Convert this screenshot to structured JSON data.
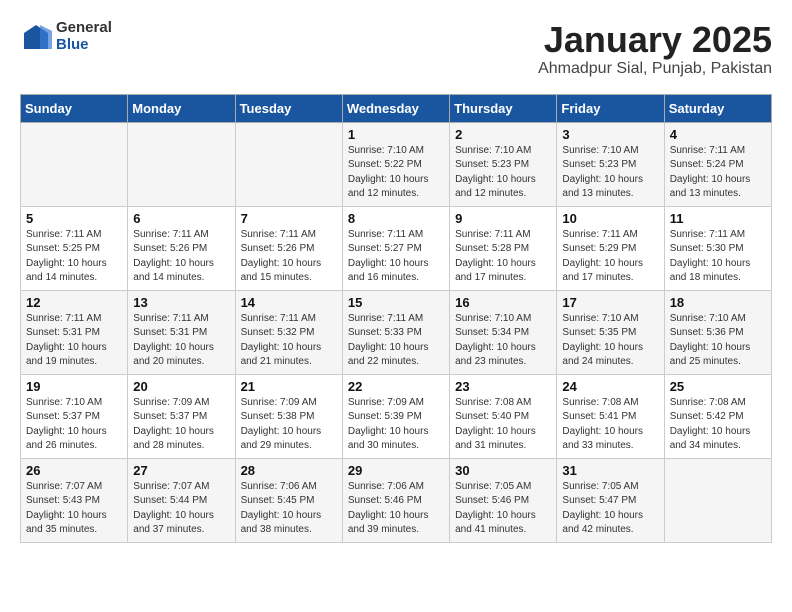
{
  "logo": {
    "general": "General",
    "blue": "Blue"
  },
  "header": {
    "title": "January 2025",
    "subtitle": "Ahmadpur Sial, Punjab, Pakistan"
  },
  "weekdays": [
    "Sunday",
    "Monday",
    "Tuesday",
    "Wednesday",
    "Thursday",
    "Friday",
    "Saturday"
  ],
  "weeks": [
    [
      {
        "day": "",
        "info": ""
      },
      {
        "day": "",
        "info": ""
      },
      {
        "day": "",
        "info": ""
      },
      {
        "day": "1",
        "info": "Sunrise: 7:10 AM\nSunset: 5:22 PM\nDaylight: 10 hours\nand 12 minutes."
      },
      {
        "day": "2",
        "info": "Sunrise: 7:10 AM\nSunset: 5:23 PM\nDaylight: 10 hours\nand 12 minutes."
      },
      {
        "day": "3",
        "info": "Sunrise: 7:10 AM\nSunset: 5:23 PM\nDaylight: 10 hours\nand 13 minutes."
      },
      {
        "day": "4",
        "info": "Sunrise: 7:11 AM\nSunset: 5:24 PM\nDaylight: 10 hours\nand 13 minutes."
      }
    ],
    [
      {
        "day": "5",
        "info": "Sunrise: 7:11 AM\nSunset: 5:25 PM\nDaylight: 10 hours\nand 14 minutes."
      },
      {
        "day": "6",
        "info": "Sunrise: 7:11 AM\nSunset: 5:26 PM\nDaylight: 10 hours\nand 14 minutes."
      },
      {
        "day": "7",
        "info": "Sunrise: 7:11 AM\nSunset: 5:26 PM\nDaylight: 10 hours\nand 15 minutes."
      },
      {
        "day": "8",
        "info": "Sunrise: 7:11 AM\nSunset: 5:27 PM\nDaylight: 10 hours\nand 16 minutes."
      },
      {
        "day": "9",
        "info": "Sunrise: 7:11 AM\nSunset: 5:28 PM\nDaylight: 10 hours\nand 17 minutes."
      },
      {
        "day": "10",
        "info": "Sunrise: 7:11 AM\nSunset: 5:29 PM\nDaylight: 10 hours\nand 17 minutes."
      },
      {
        "day": "11",
        "info": "Sunrise: 7:11 AM\nSunset: 5:30 PM\nDaylight: 10 hours\nand 18 minutes."
      }
    ],
    [
      {
        "day": "12",
        "info": "Sunrise: 7:11 AM\nSunset: 5:31 PM\nDaylight: 10 hours\nand 19 minutes."
      },
      {
        "day": "13",
        "info": "Sunrise: 7:11 AM\nSunset: 5:31 PM\nDaylight: 10 hours\nand 20 minutes."
      },
      {
        "day": "14",
        "info": "Sunrise: 7:11 AM\nSunset: 5:32 PM\nDaylight: 10 hours\nand 21 minutes."
      },
      {
        "day": "15",
        "info": "Sunrise: 7:11 AM\nSunset: 5:33 PM\nDaylight: 10 hours\nand 22 minutes."
      },
      {
        "day": "16",
        "info": "Sunrise: 7:10 AM\nSunset: 5:34 PM\nDaylight: 10 hours\nand 23 minutes."
      },
      {
        "day": "17",
        "info": "Sunrise: 7:10 AM\nSunset: 5:35 PM\nDaylight: 10 hours\nand 24 minutes."
      },
      {
        "day": "18",
        "info": "Sunrise: 7:10 AM\nSunset: 5:36 PM\nDaylight: 10 hours\nand 25 minutes."
      }
    ],
    [
      {
        "day": "19",
        "info": "Sunrise: 7:10 AM\nSunset: 5:37 PM\nDaylight: 10 hours\nand 26 minutes."
      },
      {
        "day": "20",
        "info": "Sunrise: 7:09 AM\nSunset: 5:37 PM\nDaylight: 10 hours\nand 28 minutes."
      },
      {
        "day": "21",
        "info": "Sunrise: 7:09 AM\nSunset: 5:38 PM\nDaylight: 10 hours\nand 29 minutes."
      },
      {
        "day": "22",
        "info": "Sunrise: 7:09 AM\nSunset: 5:39 PM\nDaylight: 10 hours\nand 30 minutes."
      },
      {
        "day": "23",
        "info": "Sunrise: 7:08 AM\nSunset: 5:40 PM\nDaylight: 10 hours\nand 31 minutes."
      },
      {
        "day": "24",
        "info": "Sunrise: 7:08 AM\nSunset: 5:41 PM\nDaylight: 10 hours\nand 33 minutes."
      },
      {
        "day": "25",
        "info": "Sunrise: 7:08 AM\nSunset: 5:42 PM\nDaylight: 10 hours\nand 34 minutes."
      }
    ],
    [
      {
        "day": "26",
        "info": "Sunrise: 7:07 AM\nSunset: 5:43 PM\nDaylight: 10 hours\nand 35 minutes."
      },
      {
        "day": "27",
        "info": "Sunrise: 7:07 AM\nSunset: 5:44 PM\nDaylight: 10 hours\nand 37 minutes."
      },
      {
        "day": "28",
        "info": "Sunrise: 7:06 AM\nSunset: 5:45 PM\nDaylight: 10 hours\nand 38 minutes."
      },
      {
        "day": "29",
        "info": "Sunrise: 7:06 AM\nSunset: 5:46 PM\nDaylight: 10 hours\nand 39 minutes."
      },
      {
        "day": "30",
        "info": "Sunrise: 7:05 AM\nSunset: 5:46 PM\nDaylight: 10 hours\nand 41 minutes."
      },
      {
        "day": "31",
        "info": "Sunrise: 7:05 AM\nSunset: 5:47 PM\nDaylight: 10 hours\nand 42 minutes."
      },
      {
        "day": "",
        "info": ""
      }
    ]
  ]
}
